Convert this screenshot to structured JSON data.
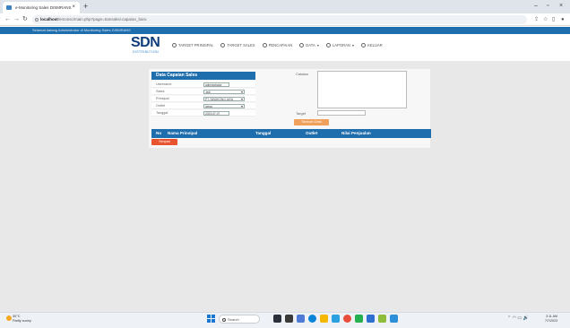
{
  "browser": {
    "tab_title": "e-Monitoring Sales DISMRANS",
    "url_host": "localhost",
    "url_path": "/emonsc/main.php?page=transaksi-capaian_baru"
  },
  "site": {
    "banner": "Selamat datang Administrator di Monitoring Sales DISMRANS",
    "logo_main": "SDN",
    "logo_sub": "DISTRIBUTION",
    "menu": [
      {
        "label": "TARGET PRINSIPAL",
        "icon": "target-icon"
      },
      {
        "label": "TARGET SALES",
        "icon": "target-icon"
      },
      {
        "label": "PENCAPAIAN",
        "icon": "chart-icon"
      },
      {
        "label": "DATA",
        "icon": "data-icon"
      },
      {
        "label": "LAPORAN",
        "icon": "report-icon"
      },
      {
        "label": "KELUAR",
        "icon": "logout-icon"
      }
    ]
  },
  "form": {
    "title": "Data Capaian Sales",
    "fields": [
      {
        "label": "Username",
        "value": "administrator"
      },
      {
        "label": "Sales",
        "value": "Jedi"
      },
      {
        "label": "Prinsipal",
        "value": "PT. SINGKONG JAYA"
      },
      {
        "label": "Outlet",
        "value": "ipega"
      },
      {
        "label": "Tanggal",
        "value": "2023-07-07"
      }
    ],
    "catatan_label": "Catatan",
    "target_label": "Target",
    "add_button": "Tambah Data",
    "save_button": "Simpan"
  },
  "table": {
    "columns": [
      "No",
      "Nama Prinsipal",
      "Tanggal",
      "Outlet",
      "Nilai Penjualan"
    ]
  },
  "taskbar": {
    "weather_temp": "30°C",
    "weather_desc": "Partly sunny",
    "search_placeholder": "Search",
    "time": "3:11 AM",
    "date": "7/7/2023"
  },
  "colors": {
    "header_blue": "#1e6dad",
    "add_button": "#f0a05a",
    "save_button": "#e8542f"
  }
}
